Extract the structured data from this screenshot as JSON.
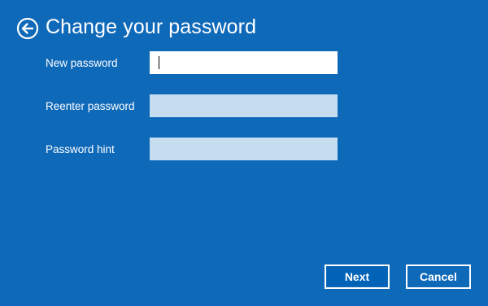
{
  "header": {
    "title": "Change your password"
  },
  "form": {
    "new_password": {
      "label": "New password",
      "value": ""
    },
    "reenter_password": {
      "label": "Reenter password",
      "value": ""
    },
    "password_hint": {
      "label": "Password hint",
      "value": ""
    }
  },
  "buttons": {
    "next_label": "Next",
    "cancel_label": "Cancel"
  },
  "colors": {
    "background": "#0f69b9",
    "inactive_field": "#c6ddf0",
    "text": "#ffffff"
  }
}
